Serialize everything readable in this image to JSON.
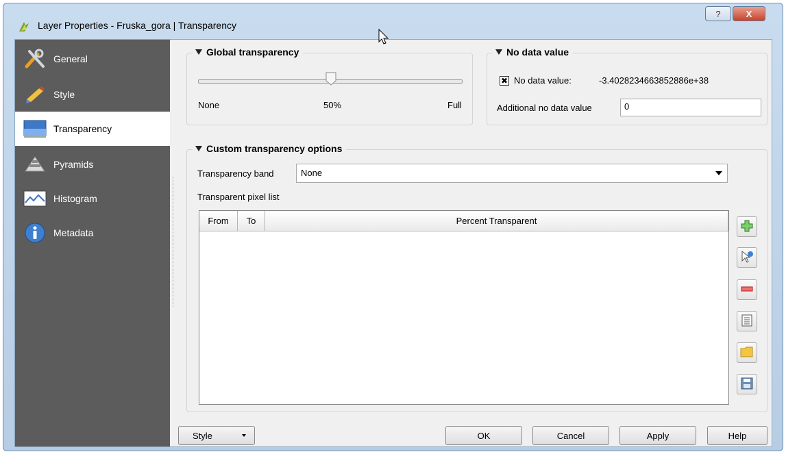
{
  "window": {
    "title": "Layer Properties - Fruska_gora | Transparency",
    "help_label": "?",
    "close_label": "X"
  },
  "sidebar": {
    "items": [
      {
        "label": "General",
        "icon": "tools-icon",
        "active": false
      },
      {
        "label": "Style",
        "icon": "paintbrush-icon",
        "active": false
      },
      {
        "label": "Transparency",
        "icon": "transparency-icon",
        "active": true
      },
      {
        "label": "Pyramids",
        "icon": "pyramids-icon",
        "active": false
      },
      {
        "label": "Histogram",
        "icon": "histogram-icon",
        "active": false
      },
      {
        "label": "Metadata",
        "icon": "info-icon",
        "active": false
      }
    ]
  },
  "global_transparency": {
    "title": "Global transparency",
    "value_percent": 50,
    "min_label": "None",
    "value_label": "50%",
    "max_label": "Full"
  },
  "no_data": {
    "title": "No data value",
    "checkbox_label": "No data value:",
    "checked": true,
    "value": "-3.4028234663852886e+38",
    "additional_label": "Additional no data value",
    "additional_value": "0"
  },
  "custom": {
    "title": "Custom transparency options",
    "band_label": "Transparency band",
    "band_value": "None",
    "pixel_list_label": "Transparent pixel list",
    "columns": [
      "From",
      "To",
      "Percent Transparent"
    ],
    "rows": []
  },
  "side_buttons": [
    {
      "name": "add-value-button",
      "icon": "plus-icon"
    },
    {
      "name": "add-from-display-button",
      "icon": "pointer-icon"
    },
    {
      "name": "remove-value-button",
      "icon": "minus-icon"
    },
    {
      "name": "default-values-button",
      "icon": "list-icon"
    },
    {
      "name": "import-from-file-button",
      "icon": "folder-icon"
    },
    {
      "name": "export-to-file-button",
      "icon": "save-icon"
    }
  ],
  "buttons": {
    "style": "Style",
    "ok": "OK",
    "cancel": "Cancel",
    "apply": "Apply",
    "help": "Help"
  },
  "colors": {
    "sidebar_bg": "#5c5c5c",
    "dialog_bg": "#f0f0f0",
    "close_red": "#c7432b"
  }
}
